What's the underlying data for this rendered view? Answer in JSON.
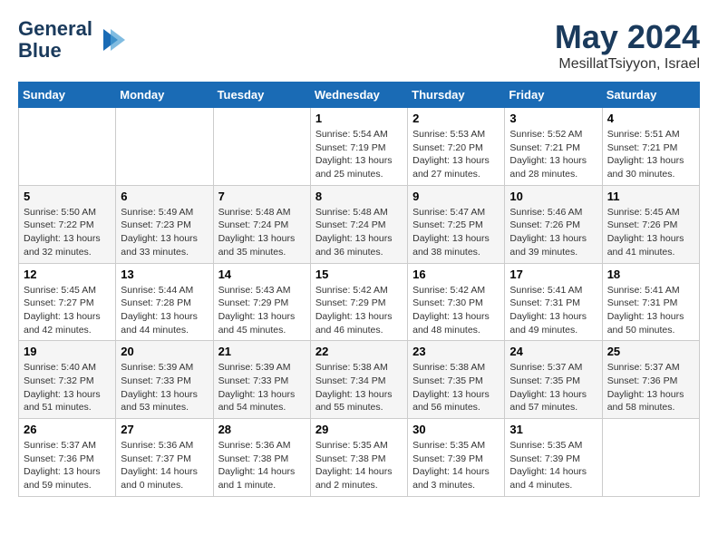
{
  "header": {
    "logo_line1": "General",
    "logo_line2": "Blue",
    "month_title": "May 2024",
    "location": "MesillatTsiyyon, Israel"
  },
  "days_of_week": [
    "Sunday",
    "Monday",
    "Tuesday",
    "Wednesday",
    "Thursday",
    "Friday",
    "Saturday"
  ],
  "weeks": [
    [
      {
        "day": "",
        "info": ""
      },
      {
        "day": "",
        "info": ""
      },
      {
        "day": "",
        "info": ""
      },
      {
        "day": "1",
        "info": "Sunrise: 5:54 AM\nSunset: 7:19 PM\nDaylight: 13 hours\nand 25 minutes."
      },
      {
        "day": "2",
        "info": "Sunrise: 5:53 AM\nSunset: 7:20 PM\nDaylight: 13 hours\nand 27 minutes."
      },
      {
        "day": "3",
        "info": "Sunrise: 5:52 AM\nSunset: 7:21 PM\nDaylight: 13 hours\nand 28 minutes."
      },
      {
        "day": "4",
        "info": "Sunrise: 5:51 AM\nSunset: 7:21 PM\nDaylight: 13 hours\nand 30 minutes."
      }
    ],
    [
      {
        "day": "5",
        "info": "Sunrise: 5:50 AM\nSunset: 7:22 PM\nDaylight: 13 hours\nand 32 minutes."
      },
      {
        "day": "6",
        "info": "Sunrise: 5:49 AM\nSunset: 7:23 PM\nDaylight: 13 hours\nand 33 minutes."
      },
      {
        "day": "7",
        "info": "Sunrise: 5:48 AM\nSunset: 7:24 PM\nDaylight: 13 hours\nand 35 minutes."
      },
      {
        "day": "8",
        "info": "Sunrise: 5:48 AM\nSunset: 7:24 PM\nDaylight: 13 hours\nand 36 minutes."
      },
      {
        "day": "9",
        "info": "Sunrise: 5:47 AM\nSunset: 7:25 PM\nDaylight: 13 hours\nand 38 minutes."
      },
      {
        "day": "10",
        "info": "Sunrise: 5:46 AM\nSunset: 7:26 PM\nDaylight: 13 hours\nand 39 minutes."
      },
      {
        "day": "11",
        "info": "Sunrise: 5:45 AM\nSunset: 7:26 PM\nDaylight: 13 hours\nand 41 minutes."
      }
    ],
    [
      {
        "day": "12",
        "info": "Sunrise: 5:45 AM\nSunset: 7:27 PM\nDaylight: 13 hours\nand 42 minutes."
      },
      {
        "day": "13",
        "info": "Sunrise: 5:44 AM\nSunset: 7:28 PM\nDaylight: 13 hours\nand 44 minutes."
      },
      {
        "day": "14",
        "info": "Sunrise: 5:43 AM\nSunset: 7:29 PM\nDaylight: 13 hours\nand 45 minutes."
      },
      {
        "day": "15",
        "info": "Sunrise: 5:42 AM\nSunset: 7:29 PM\nDaylight: 13 hours\nand 46 minutes."
      },
      {
        "day": "16",
        "info": "Sunrise: 5:42 AM\nSunset: 7:30 PM\nDaylight: 13 hours\nand 48 minutes."
      },
      {
        "day": "17",
        "info": "Sunrise: 5:41 AM\nSunset: 7:31 PM\nDaylight: 13 hours\nand 49 minutes."
      },
      {
        "day": "18",
        "info": "Sunrise: 5:41 AM\nSunset: 7:31 PM\nDaylight: 13 hours\nand 50 minutes."
      }
    ],
    [
      {
        "day": "19",
        "info": "Sunrise: 5:40 AM\nSunset: 7:32 PM\nDaylight: 13 hours\nand 51 minutes."
      },
      {
        "day": "20",
        "info": "Sunrise: 5:39 AM\nSunset: 7:33 PM\nDaylight: 13 hours\nand 53 minutes."
      },
      {
        "day": "21",
        "info": "Sunrise: 5:39 AM\nSunset: 7:33 PM\nDaylight: 13 hours\nand 54 minutes."
      },
      {
        "day": "22",
        "info": "Sunrise: 5:38 AM\nSunset: 7:34 PM\nDaylight: 13 hours\nand 55 minutes."
      },
      {
        "day": "23",
        "info": "Sunrise: 5:38 AM\nSunset: 7:35 PM\nDaylight: 13 hours\nand 56 minutes."
      },
      {
        "day": "24",
        "info": "Sunrise: 5:37 AM\nSunset: 7:35 PM\nDaylight: 13 hours\nand 57 minutes."
      },
      {
        "day": "25",
        "info": "Sunrise: 5:37 AM\nSunset: 7:36 PM\nDaylight: 13 hours\nand 58 minutes."
      }
    ],
    [
      {
        "day": "26",
        "info": "Sunrise: 5:37 AM\nSunset: 7:36 PM\nDaylight: 13 hours\nand 59 minutes."
      },
      {
        "day": "27",
        "info": "Sunrise: 5:36 AM\nSunset: 7:37 PM\nDaylight: 14 hours\nand 0 minutes."
      },
      {
        "day": "28",
        "info": "Sunrise: 5:36 AM\nSunset: 7:38 PM\nDaylight: 14 hours\nand 1 minute."
      },
      {
        "day": "29",
        "info": "Sunrise: 5:35 AM\nSunset: 7:38 PM\nDaylight: 14 hours\nand 2 minutes."
      },
      {
        "day": "30",
        "info": "Sunrise: 5:35 AM\nSunset: 7:39 PM\nDaylight: 14 hours\nand 3 minutes."
      },
      {
        "day": "31",
        "info": "Sunrise: 5:35 AM\nSunset: 7:39 PM\nDaylight: 14 hours\nand 4 minutes."
      },
      {
        "day": "",
        "info": ""
      }
    ]
  ]
}
